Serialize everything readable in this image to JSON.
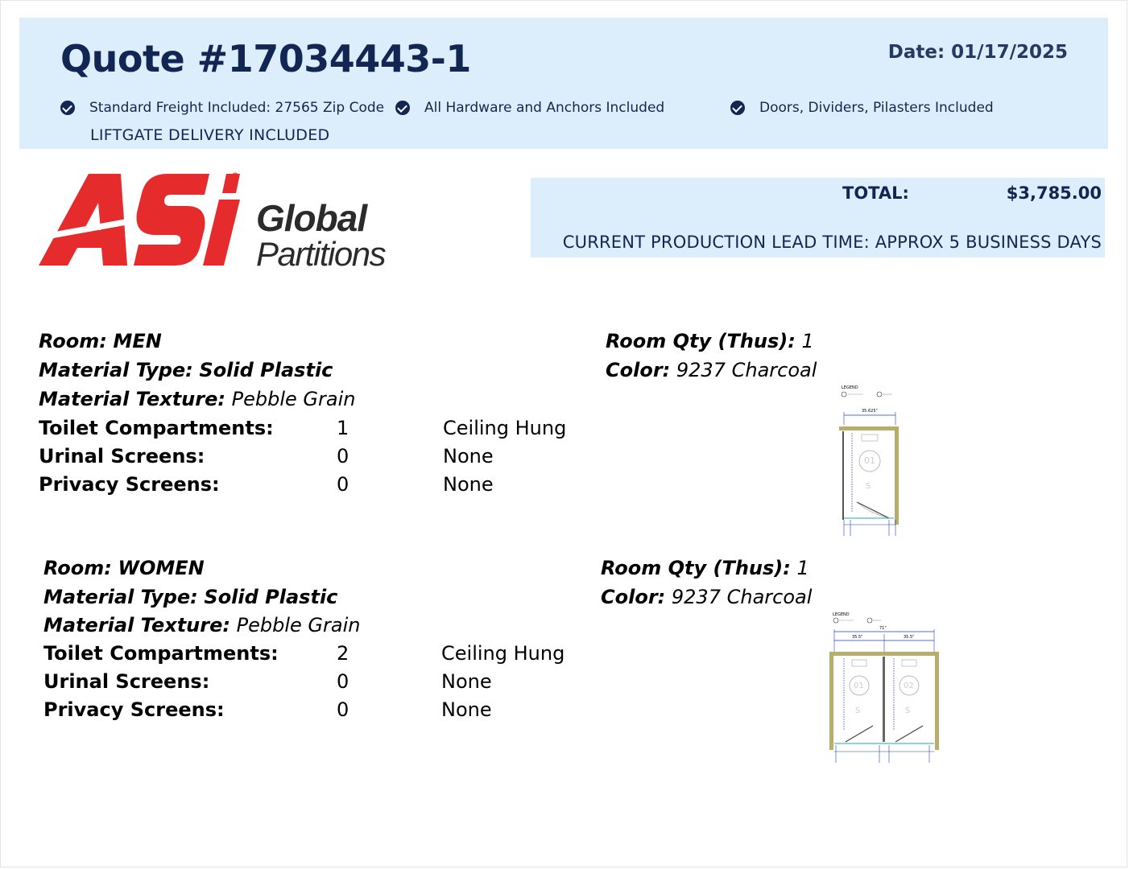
{
  "header": {
    "quote_title": "Quote #17034443-1",
    "date_label": "Date:",
    "date_value": "01/17/2025",
    "features": [
      "Standard Freight Included: 27565 Zip Code",
      "All Hardware and Anchors Included",
      "Doors, Dividers, Pilasters Included"
    ],
    "liftgate": "LIFTGATE DELIVERY INCLUDED"
  },
  "logo": {
    "brand": "ASI",
    "line1": "Global",
    "line2": "Partitions",
    "brand_color": "#e52b2b"
  },
  "totals": {
    "total_label": "TOTAL:",
    "total_value": "$3,785.00",
    "lead_time": "CURRENT PRODUCTION LEAD TIME: APPROX 5 BUSINESS DAYS"
  },
  "colors": {
    "header_bg": "#dceefb",
    "navy": "#122654",
    "panel_olive": "#b8ad6b"
  },
  "rooms": [
    {
      "room_label": "Room:",
      "room_value": "MEN",
      "material_type_label": "Material Type:",
      "material_type_value": "Solid Plastic",
      "material_texture_label": "Material Texture:",
      "material_texture_value": "Pebble Grain",
      "qty_label": "Room Qty (Thus):",
      "qty_value": "1",
      "color_label": "Color:",
      "color_value": "9237 Charcoal",
      "rows": [
        {
          "label": "Toilet Compartments:",
          "qty": "1",
          "type": "Ceiling Hung"
        },
        {
          "label": "Urinal Screens:",
          "qty": "0",
          "type": "None"
        },
        {
          "label": "Privacy Screens:",
          "qty": "0",
          "type": "None"
        }
      ],
      "diagram": {
        "legend": "LEGEND",
        "width_dim": "35.625\"",
        "stalls": [
          "01"
        ],
        "stall_marker": "S"
      }
    },
    {
      "room_label": "Room:",
      "room_value": "WOMEN",
      "material_type_label": "Material Type:",
      "material_type_value": "Solid Plastic",
      "material_texture_label": "Material Texture:",
      "material_texture_value": "Pebble Grain",
      "qty_label": "Room Qty (Thus):",
      "qty_value": "1",
      "color_label": "Color:",
      "color_value": "9237 Charcoal",
      "rows": [
        {
          "label": "Toilet Compartments:",
          "qty": "2",
          "type": "Ceiling Hung"
        },
        {
          "label": "Urinal Screens:",
          "qty": "0",
          "type": "None"
        },
        {
          "label": "Privacy Screens:",
          "qty": "0",
          "type": "None"
        }
      ],
      "diagram": {
        "legend": "LEGEND",
        "total_dim": "71\"",
        "stall_dims": [
          "35.5\"",
          "35.5\""
        ],
        "stalls": [
          "01",
          "02"
        ],
        "stall_marker": "S"
      }
    }
  ]
}
